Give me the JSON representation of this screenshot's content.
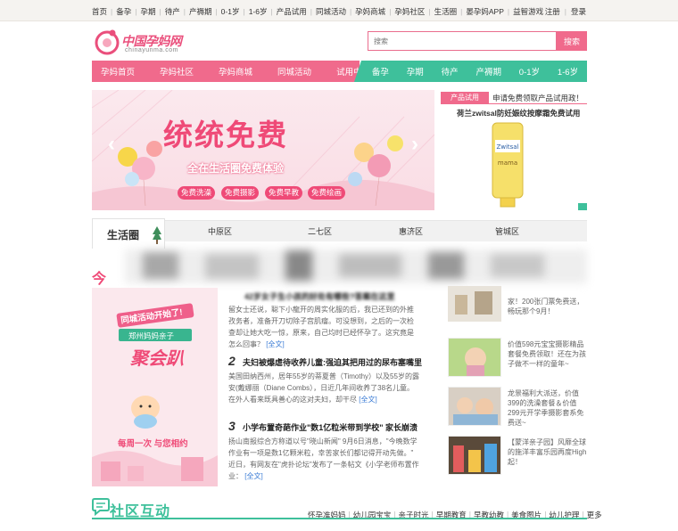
{
  "top_nav": [
    "首页",
    "备孕",
    "孕期",
    "待产",
    "产褥期",
    "0-1岁",
    "1-6岁",
    "产品试用",
    "同城活动",
    "孕妈商城",
    "孕妈社区",
    "生活圈",
    "晏孕妈APP",
    "益智游戏"
  ],
  "top_auth": [
    "注册",
    "登录"
  ],
  "logo": {
    "name": "中国孕妈网",
    "domain": "chinayunma.com"
  },
  "search": {
    "placeholder": "搜索",
    "button": "搜索"
  },
  "nav_pink": [
    "孕妈首页",
    "孕妈社区",
    "孕妈商城",
    "同城活动",
    "试用中心"
  ],
  "nav_green": [
    "备孕",
    "孕期",
    "待产",
    "产褥期",
    "0-1岁",
    "1-6岁"
  ],
  "banner": {
    "title": "统统免费",
    "subtitle": "全在生活圈免费体验",
    "pills": [
      "免费洗澡",
      "免费摄影",
      "免费早教",
      "免费绘画"
    ]
  },
  "trial": {
    "tag": "产品试用",
    "headline": "申请免费领取产品试用政！",
    "product": "荷兰zwitsal防妊娠纹按摩霜免费试用",
    "brand": "Zwitsal",
    "brand_sub": "mama"
  },
  "life_circle": {
    "title": "生活圈",
    "districts": [
      "中原区",
      "二七区",
      "惠济区",
      "管城区"
    ]
  },
  "section_title": "今",
  "promo": {
    "line1": "同城活动开始了!",
    "ribbon": "郑州妈妈亲子",
    "big": "聚会趴",
    "bottom": "每周一次 与您相约"
  },
  "articles": [
    {
      "num": "",
      "title": "42岁女子生小孩的好处有哪些?答案在这里",
      "body": "留女士还说，聪下小龍开的周实化服的后，我已还到的外推孜务者，准备开刀切除子宫肌瘤。可没想到，之后的一次检查却让她大吃一惊，原来，自己均时已经怀孕了。这究竟是怎么回事？",
      "more": "[全文]"
    },
    {
      "num": "2",
      "title": "夫妇被爆虐待收养儿童:强迫其把用过的尿布塞嘴里",
      "body": "美国田纳西州，居年55岁的蒂夏普（Timothy）以及55岁的露安(戴娜丽（Diane Combs），日近几年间收养了38名儿童。在外人看来既具善心的这对夫妇，却干尽",
      "more": "[全文]"
    },
    {
      "num": "3",
      "title": "小学布置奇葩作业\"数1亿粒米带到学校\" 家长崩溃",
      "body": "扬山南报综合方称道以号\"晓山新闻\" 9月6日消息，\"今晚数学作业有一项是数1亿颗米粒，幸苦家长们都记得开动先做。\" 近日，有网友在\"虎扑论坛\"发布了一条帖文《小学老师布置作业：",
      "more": "[全文]"
    }
  ],
  "right_list": [
    {
      "text": "家！200张门票免费送，畅玩那个9月！"
    },
    {
      "text": "价值598元宝宝摄影精品套餐免费领取！还在为孩子做不一样的童年~"
    },
    {
      "text": "龙景福利大派送，价值399的洗澡套餐＆价值299元开学季摄影套系免费送~"
    },
    {
      "text": "【蒙洋亲子园】风靡全球的施洋丰富乐园再度High起！"
    }
  ],
  "community": {
    "title": "社区互动",
    "links": [
      "怀孕准妈妈",
      "幼儿园宝宝",
      "亲子时光",
      "早期教育",
      "早教幼教",
      "美食图片",
      "幼儿护理",
      "更多"
    ]
  },
  "colors": {
    "pink": "#f06a8c",
    "green": "#3ec09b"
  }
}
